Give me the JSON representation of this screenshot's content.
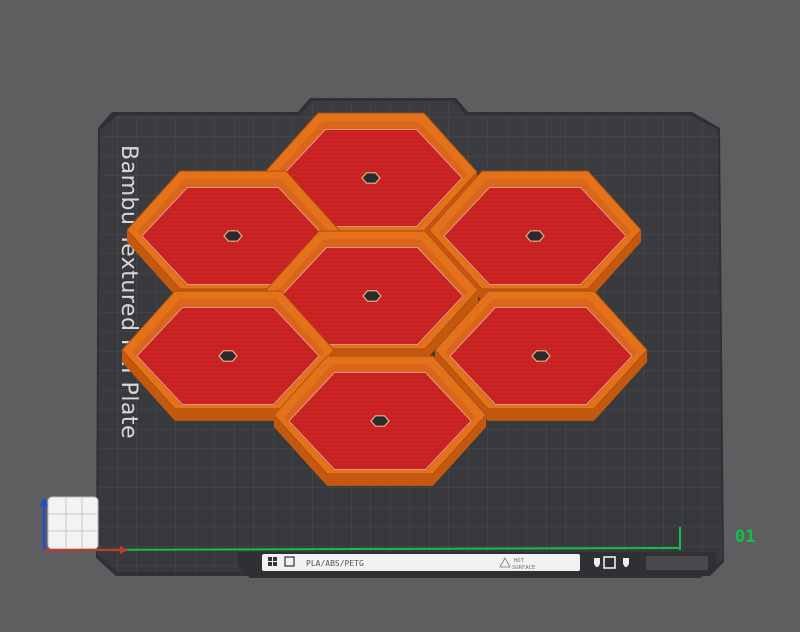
{
  "plate": {
    "brand_label": "Bambu Textured PEI Plate",
    "plate_number": "01",
    "number_color": "#12c04a"
  },
  "bottom_badge": {
    "filament_types": "PLA/ABS/PETG",
    "surface_line1": "HOT",
    "surface_line2": "SURFACE",
    "icons": [
      "grid-icon",
      "shield-icon",
      "pin-icon",
      "square-icon",
      "pin-icon"
    ]
  },
  "objects": {
    "name": "hex-tray",
    "count": 7,
    "color_fill": "#cc2424",
    "color_wall": "#e4721b"
  },
  "axes": {
    "x_color": "#c0392b",
    "y_color": "#12c04a",
    "z_color": "#1f48d4"
  }
}
